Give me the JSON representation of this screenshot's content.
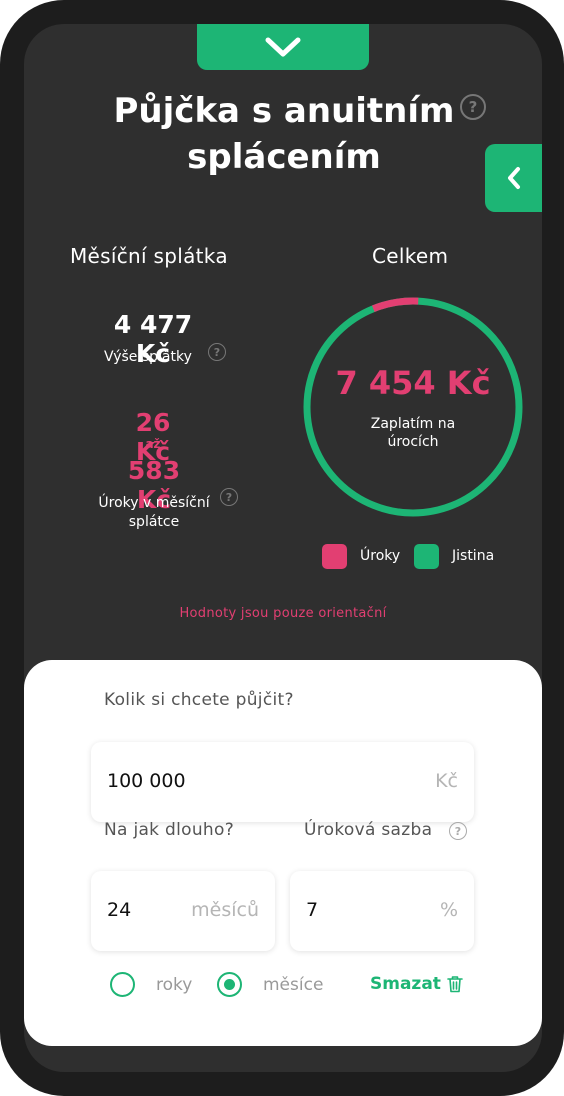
{
  "header": {
    "title": "Půjčka s anuitním splácením",
    "collapse_icon": "chevron-down-icon",
    "side_toggle_icon": "chevron-left-icon",
    "help_icon": "question-circle-icon"
  },
  "summary": {
    "monthly_label": "Měsíční splátka",
    "total_label": "Celkem",
    "monthly_payment": "4 477 Kč",
    "monthly_payment_label": "Výše splátky",
    "interest_from": "26 Kč",
    "interest_to_word": "až",
    "interest_to": "583 Kč",
    "interest_label": "Úroky v měsíční splátce",
    "total_interest": "7 454 Kč",
    "total_interest_label": "Zaplatím na úrocích",
    "disclaimer": "Hodnoty jsou pouze orientační"
  },
  "donut": {
    "interest_share": 0.069,
    "interest_color": "#e23f72",
    "principal_color": "#1db575"
  },
  "legend": {
    "interest": "Úroky",
    "principal": "Jistina"
  },
  "form": {
    "amount_label": "Kolik si chcete půjčit?",
    "amount_value": "100 000",
    "amount_unit": "Kč",
    "duration_label": "Na jak dlouho?",
    "duration_value": "24",
    "duration_unit": "měsíců",
    "rate_label": "Úroková sazba",
    "rate_value": "7",
    "rate_unit": "%",
    "radio_years": "roky",
    "radio_months": "měsíce",
    "selected_unit": "months",
    "clear_label": "Smazat",
    "clear_icon": "trash-icon"
  },
  "colors": {
    "accent": "#1db575",
    "highlight": "#e23f72",
    "background": "#2f2f2f"
  }
}
